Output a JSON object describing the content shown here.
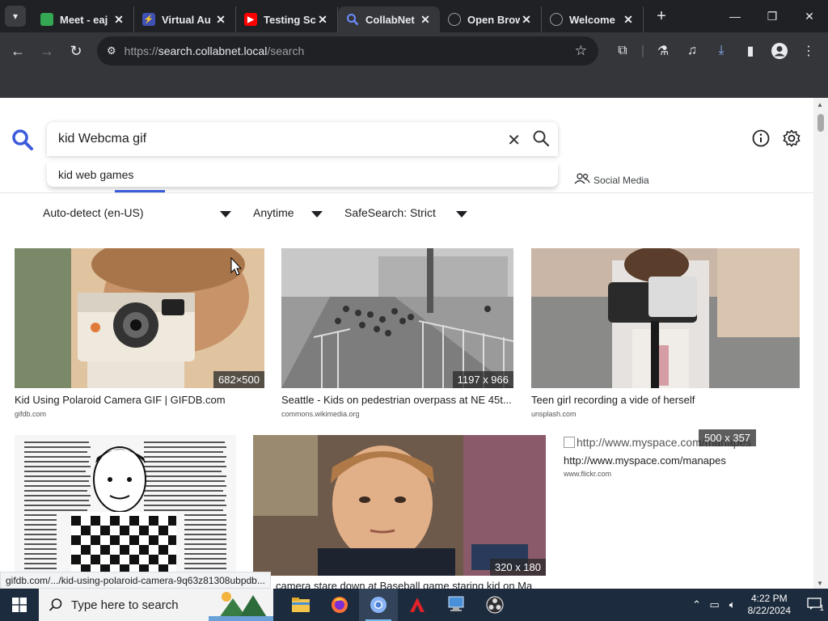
{
  "browser": {
    "tabs": [
      {
        "title": "Meet - eaj",
        "favicon": "meet-icon",
        "color": "#34a853"
      },
      {
        "title": "Virtual Au",
        "favicon": "virtual-icon",
        "color": "#3f51b5"
      },
      {
        "title": "Testing Sc",
        "favicon": "youtube-icon",
        "color": "#ff0000"
      },
      {
        "title": "CollabNet",
        "favicon": "search-icon",
        "color": "#4c6ef5",
        "active": true
      },
      {
        "title": "Open Brow",
        "favicon": "globe-icon",
        "color": "#9aa0a6"
      },
      {
        "title": "Welcome",
        "favicon": "globe-icon",
        "color": "#9aa0a6"
      }
    ],
    "url_prefix": "https://",
    "url_host": "search.collabnet.local",
    "url_path": "/search"
  },
  "search": {
    "query": "kid Webcma gif",
    "suggestion": "kid web games",
    "social_tab": "Social Media"
  },
  "filters": {
    "region": "Auto-detect (en-US)",
    "time": "Anytime",
    "safesearch": "SafeSearch: Strict"
  },
  "results": [
    {
      "title": "Kid Using Polaroid Camera GIF | GIFDB.com",
      "source": "gifdb.com",
      "dims": "682×500"
    },
    {
      "title": "Seattle - Kids on pedestrian overpass at NE 45t...",
      "source": "commons.wikimedia.org",
      "dims": "1197 x 966"
    },
    {
      "title": "Teen girl recording a vide of herself",
      "source": "unsplash.com",
      "dims": ""
    },
    {
      "title": "",
      "source": "",
      "dims": ""
    },
    {
      "title": "camera stare down at Baseball game staring kid on Ma",
      "source": "",
      "dims": "320 x 180"
    },
    {
      "title": "http://www.myspace.com/manapes",
      "source": "www.flickr.com",
      "dims": "500 x 357",
      "alt": "http://www.myspace.com/manapes"
    }
  ],
  "status_url": "gifdb.com/.../kid-using-polaroid-camera-9q63z81308ubpdb...",
  "taskbar": {
    "search_placeholder": "Type here to search",
    "time": "4:22 PM",
    "date": "8/22/2024",
    "notification_count": "1"
  }
}
